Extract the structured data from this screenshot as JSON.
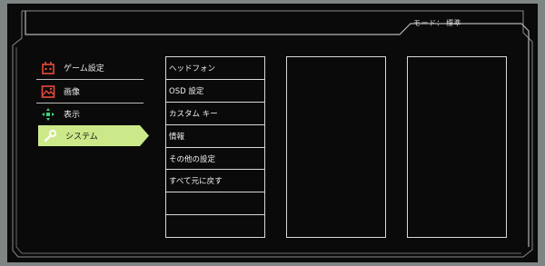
{
  "header": {
    "mode_label": "モード：",
    "mode_value": "標準"
  },
  "main_menu": {
    "items": [
      {
        "label": "ゲーム設定",
        "icon": "game-settings-icon"
      },
      {
        "label": "画像",
        "icon": "picture-icon"
      },
      {
        "label": "表示",
        "icon": "display-icon"
      },
      {
        "label": "システム",
        "icon": "wrench-icon",
        "selected": true
      }
    ],
    "selected_color": "#cce98a",
    "icon_color": "#e84a3a",
    "display_icon_color": "#3fd07a"
  },
  "sub_menu": {
    "items": [
      "ヘッドフォン",
      "OSD 設定",
      "カスタム キー",
      "情報",
      "その他の設定",
      "すべて元に戻す",
      "",
      ""
    ]
  }
}
